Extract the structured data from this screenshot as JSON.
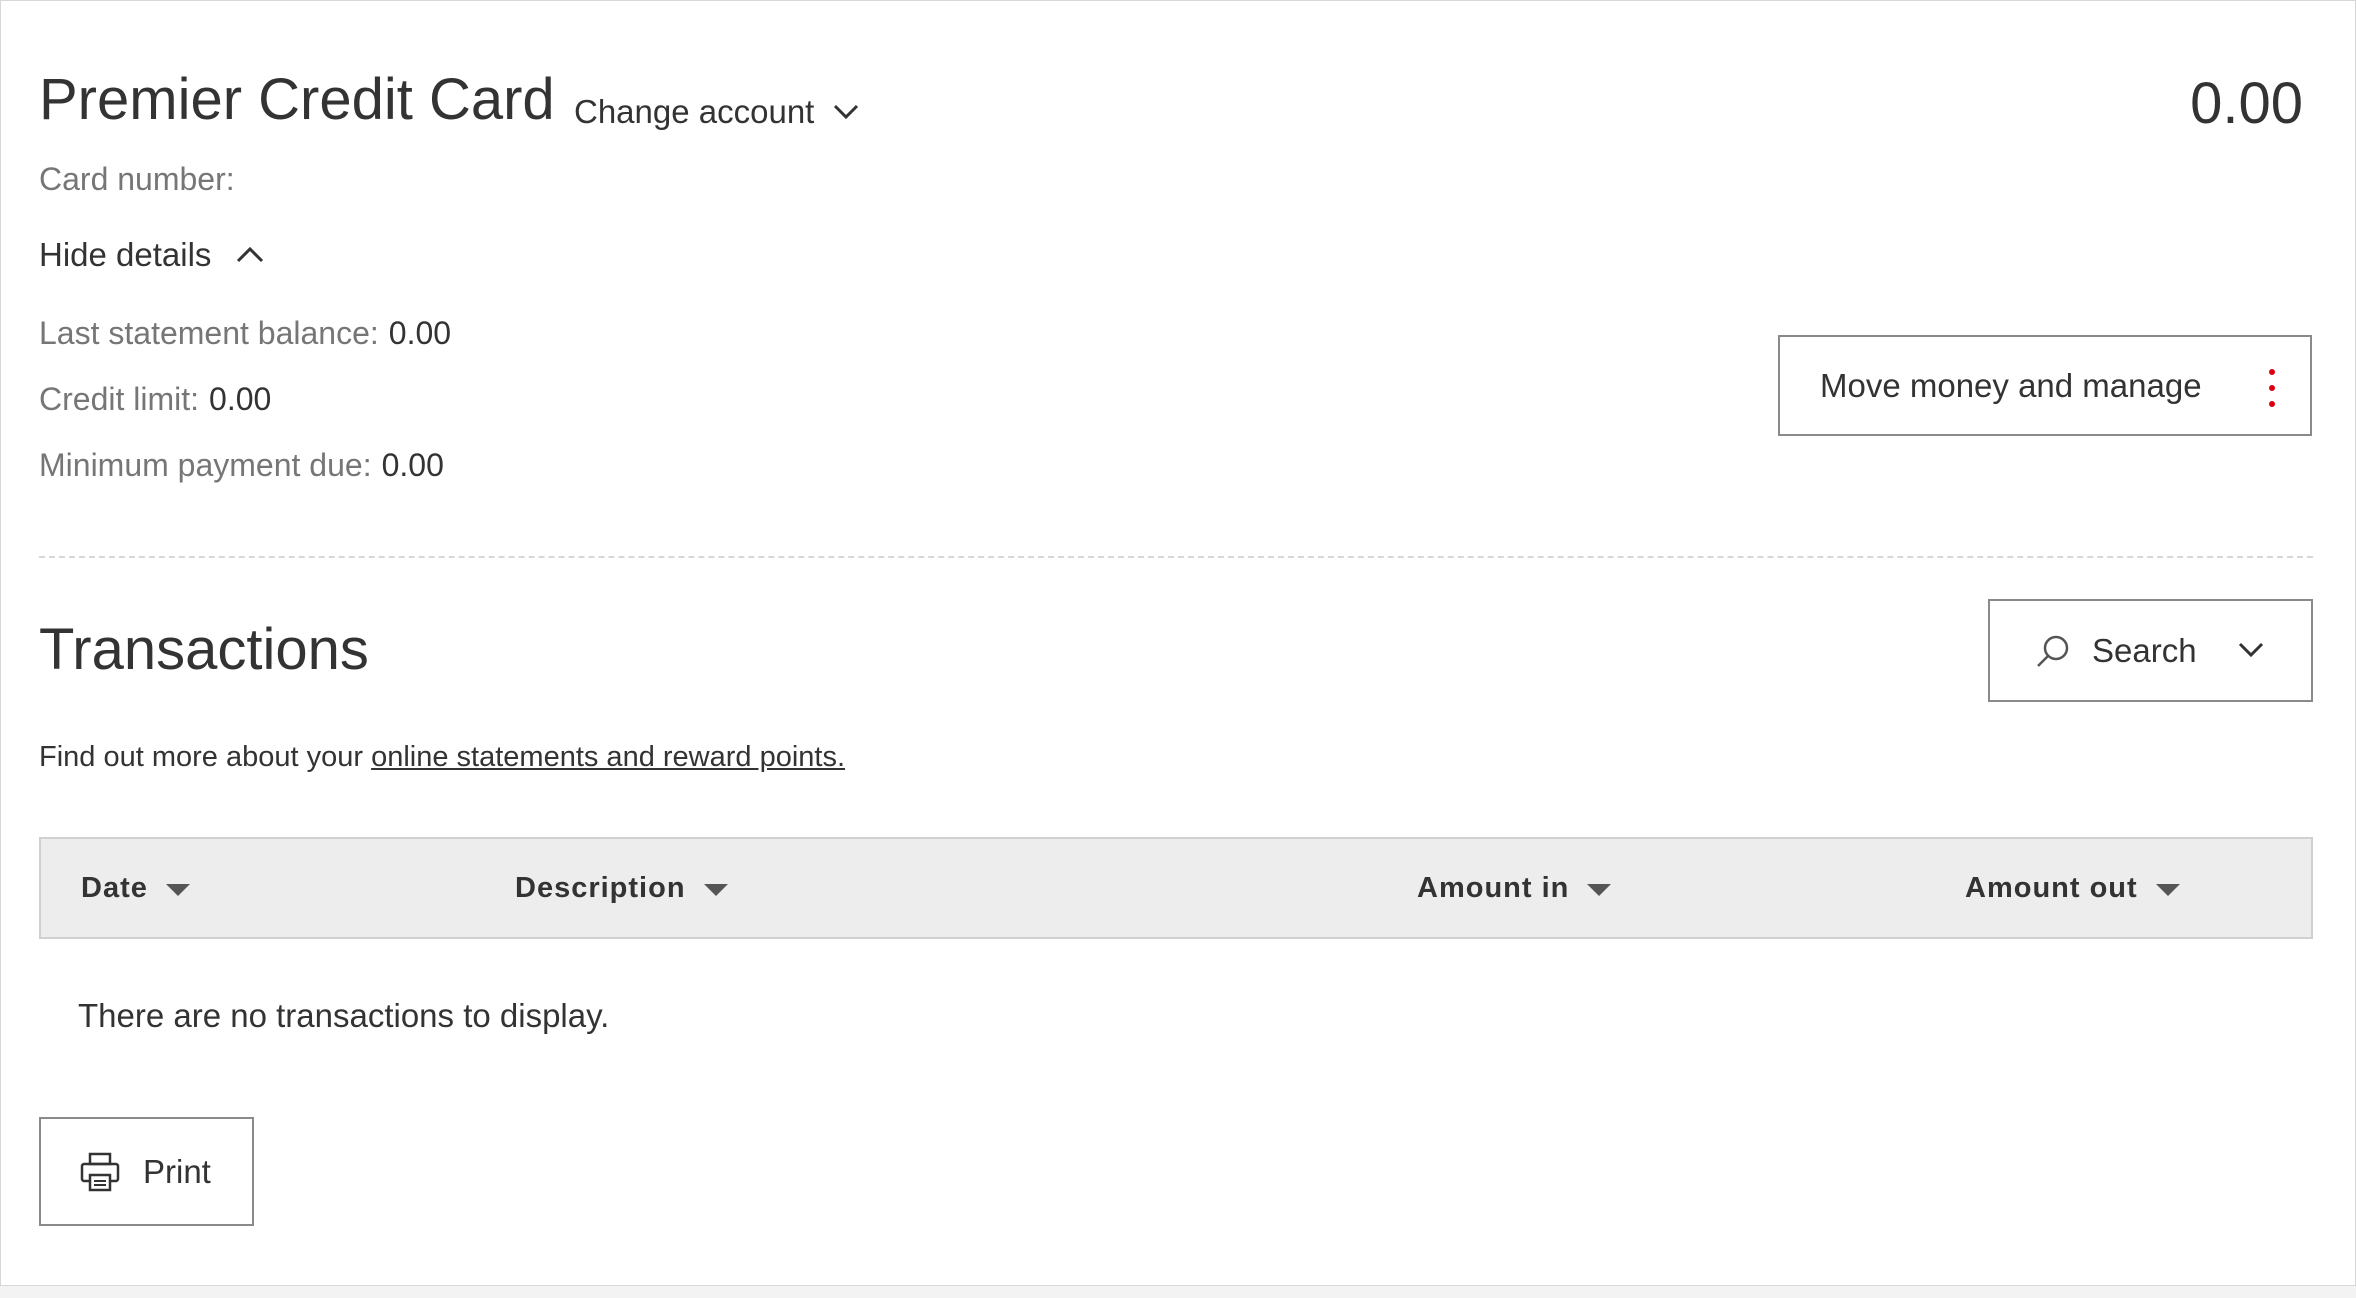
{
  "account": {
    "title": "Premier Credit Card",
    "change_account_label": "Change account",
    "balance": "0.00",
    "card_number_label": "Card number:",
    "hide_details_label": "Hide details"
  },
  "details": {
    "last_statement_label": "Last statement balance:",
    "last_statement_value": "0.00",
    "credit_limit_label": "Credit limit:",
    "credit_limit_value": "0.00",
    "min_payment_label": "Minimum payment due:",
    "min_payment_value": "0.00"
  },
  "actions": {
    "move_money_label": "Move money and manage"
  },
  "transactions": {
    "title": "Transactions",
    "search_label": "Search",
    "info_prefix": "Find out more about your ",
    "info_link": "online statements and reward points.",
    "columns": [
      "Date",
      "Description",
      "Amount in",
      "Amount out"
    ],
    "empty_message": "There are no transactions to display.",
    "print_label": "Print"
  },
  "icons": {
    "change_account": "chevron-down-icon",
    "hide_details": "chevron-up-icon",
    "move_money_menu": "kebab-menu-icon",
    "search": "search-icon",
    "search_toggle": "chevron-down-icon",
    "sort": "sort-caret-icon",
    "print": "printer-icon"
  },
  "colors": {
    "accent": "#db0011",
    "text": "#333333",
    "muted_text": "#767676",
    "table_header_bg": "#ededed"
  }
}
